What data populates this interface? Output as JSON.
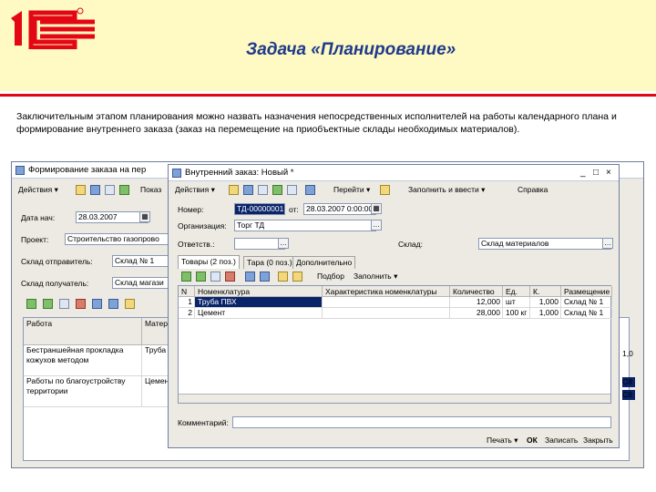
{
  "slide": {
    "title": "Задача «Планирование»",
    "intro": "Заключительным этапом планирования можно назвать назначения непосредственных исполнителей на работы календарного плана и формирование внутреннего заказа (заказ на перемещение на приобъектные склады необходимых материалов).",
    "colors": {
      "header_bg": "#fff9c4",
      "accent_red": "#e30613",
      "title_blue": "#1f3b8a"
    }
  },
  "back_window": {
    "title": "Формирование заказа на пер",
    "toolbar": {
      "actions": "Действия",
      "show": "Показ"
    },
    "date_label": "Дата нач:",
    "date_value": "28.03.2007",
    "project_label": "Проект:",
    "project_value": "Строительство газопрово",
    "sender_label": "Склад отправитель:",
    "sender_value": "Склад № 1",
    "receiver_label": "Склад получатель:",
    "receiver_value": "Склад магази",
    "columns": [
      "Работа",
      "Матери"
    ],
    "rows": [
      {
        "work": "Бестраншейная прокладка кожухов методом",
        "material": "Труба П"
      },
      {
        "work": "Работы по благоустройству территории",
        "material": "Цемент"
      }
    ],
    "right_edge": {
      "val1": "1,0",
      "val2": "C8",
      "val3": "C8"
    }
  },
  "front_window": {
    "title": "Внутренний заказ: Новый *",
    "toolbar": {
      "actions": "Действия",
      "goto": "Перейти",
      "fill_enter": "Заполнить и ввести",
      "help": "Справка"
    },
    "number_label": "Номер:",
    "number_value": "ТД-00000001",
    "from_label": "от:",
    "from_value": "28.03.2007 0:00:00",
    "org_label": "Организация:",
    "org_value": "Торг ТД",
    "warehouse_label": "Склад:",
    "warehouse_value": "Склад материалов",
    "responsible_label": "Ответств.:",
    "tabs": [
      "Товары (2 поз.)",
      "Тара (0 поз.)",
      "Дополнительно"
    ],
    "grid_buttons": {
      "pick": "Подбор",
      "fill": "Заполнить"
    },
    "columns": [
      "N",
      "Номенклатура",
      "Характеристика номенклатуры",
      "Количество",
      "Ед.",
      "К.",
      "Размещение"
    ],
    "rows": [
      {
        "n": "1",
        "name": "Труба ПВХ",
        "char": "",
        "qty": "12,000",
        "unit": "шт",
        "k": "1,000",
        "place": "Склад № 1"
      },
      {
        "n": "2",
        "name": "Цемент",
        "char": "",
        "qty": "28,000",
        "unit": "100 кг",
        "k": "1,000",
        "place": "Склад № 1"
      }
    ],
    "comment_label": "Комментарий:",
    "bottom_buttons": {
      "print": "Печать",
      "ok": "ОК",
      "save": "Записать",
      "close": "Закрыть"
    }
  }
}
